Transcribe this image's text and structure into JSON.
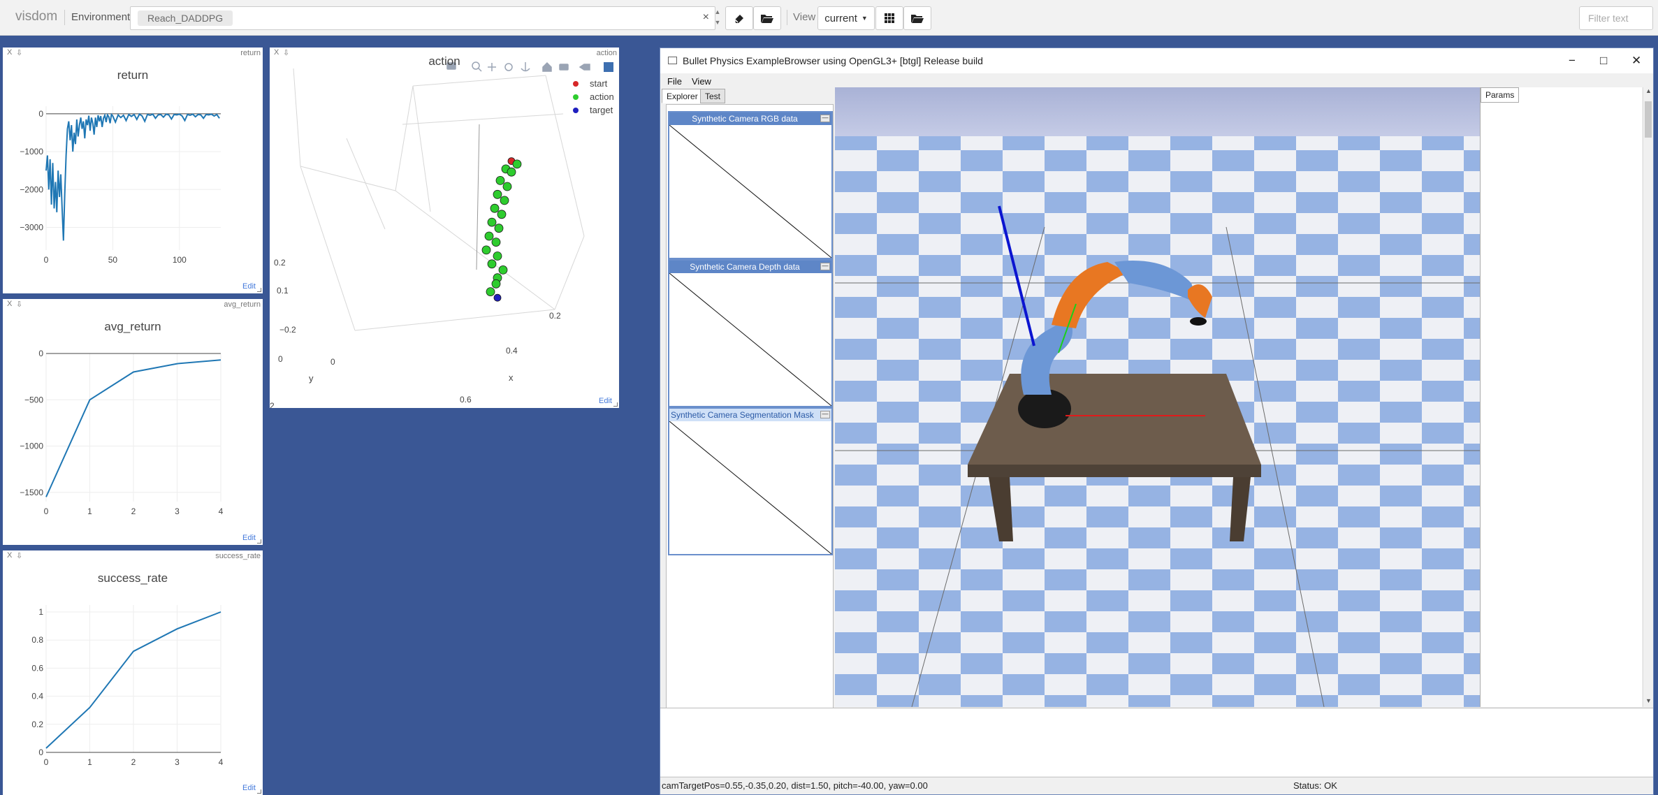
{
  "topbar": {
    "brand": "visdom",
    "env_label": "Environment",
    "env_chip": "Reach_DADDPG",
    "env_clear": "×",
    "view_label": "View",
    "view_value": "current",
    "filter_placeholder": "Filter text"
  },
  "panes": [
    {
      "close": "X",
      "name": "return",
      "edit": "Edit"
    },
    {
      "close": "X",
      "name": "action",
      "edit": "Edit"
    },
    {
      "close": "X",
      "name": "avg_return",
      "edit": "Edit"
    },
    {
      "close": "X",
      "name": "success_rate",
      "edit": "Edit"
    }
  ],
  "chart_data": [
    {
      "type": "line",
      "title": "return",
      "xlabel": "",
      "ylabel": "",
      "xlim": [
        0,
        131
      ],
      "ylim": [
        -3600,
        200
      ],
      "xticks": [
        "0",
        "50",
        "100"
      ],
      "yticks": [
        "0",
        "−1000",
        "−2000",
        "−3000"
      ],
      "series": [
        {
          "color": "#1f77b4",
          "x": [
            0,
            1,
            2,
            3,
            4,
            5,
            6,
            7,
            8,
            9,
            10,
            11,
            12,
            13,
            14,
            15,
            16,
            17,
            18,
            19,
            20,
            21,
            22,
            23,
            24,
            25,
            26,
            27,
            28,
            29,
            30,
            31,
            32,
            33,
            34,
            35,
            36,
            37,
            38,
            39,
            40,
            41,
            42,
            43,
            44,
            45,
            46,
            47,
            48,
            49,
            50,
            52,
            54,
            56,
            58,
            60,
            62,
            64,
            66,
            68,
            70,
            72,
            74,
            76,
            78,
            80,
            82,
            84,
            86,
            88,
            90,
            92,
            94,
            96,
            98,
            100,
            102,
            104,
            106,
            108,
            110,
            112,
            114,
            116,
            118,
            120,
            122,
            124,
            126,
            128,
            130
          ],
          "y": [
            -1500,
            -1100,
            -2000,
            -1200,
            -2400,
            -1300,
            -2500,
            -1800,
            -2600,
            -1500,
            -2200,
            -1600,
            -2500,
            -3350,
            -2100,
            -1100,
            -400,
            -200,
            -700,
            -300,
            -1000,
            -500,
            -800,
            -150,
            -600,
            -300,
            -100,
            -400,
            -200,
            -650,
            -150,
            -300,
            -50,
            -450,
            -100,
            -250,
            -550,
            -100,
            -350,
            -40,
            -200,
            -60,
            -350,
            -120,
            -40,
            -220,
            -30,
            -80,
            -250,
            -20,
            -60,
            -220,
            -30,
            -100,
            -40,
            -180,
            -20,
            -70,
            -20,
            -150,
            -10,
            -60,
            -200,
            -20,
            -40,
            -10,
            -120,
            -30,
            -20,
            -90,
            -10,
            -30,
            -140,
            -20,
            -30,
            -10,
            -60,
            -180,
            -20,
            -40,
            -10,
            -80,
            -20,
            -30,
            -120,
            -20,
            -30,
            -10,
            -60,
            -20,
            -120
          ]
        }
      ]
    },
    {
      "type": "scatter3d",
      "title": "action",
      "xlabel": "x",
      "ylabel": "y",
      "series": [
        {
          "name": "start",
          "color": "#d62728",
          "points": [
            [
              0.55,
              0.12,
              0.21
            ]
          ]
        },
        {
          "name": "action",
          "color": "#2ecc2e",
          "points": [
            [
              0.56,
              0.11,
              0.2
            ],
            [
              0.54,
              0.13,
              0.19
            ],
            [
              0.55,
              0.12,
              0.18
            ],
            [
              0.53,
              0.14,
              0.16
            ],
            [
              0.54,
              0.12,
              0.14
            ],
            [
              0.52,
              0.13,
              0.12
            ],
            [
              0.53,
              0.11,
              0.1
            ],
            [
              0.51,
              0.12,
              0.08
            ],
            [
              0.52,
              0.1,
              0.06
            ],
            [
              0.5,
              0.11,
              0.04
            ],
            [
              0.51,
              0.09,
              0.02
            ],
            [
              0.49,
              0.1,
              0.0
            ],
            [
              0.5,
              0.08,
              -0.02
            ],
            [
              0.48,
              0.09,
              -0.04
            ],
            [
              0.5,
              0.07,
              -0.06
            ],
            [
              0.49,
              0.08,
              -0.08
            ],
            [
              0.51,
              0.06,
              -0.1
            ],
            [
              0.5,
              0.07,
              -0.12
            ],
            [
              0.49,
              0.05,
              -0.14
            ],
            [
              0.48,
              0.06,
              -0.16
            ]
          ]
        },
        {
          "name": "target",
          "color": "#1f1fbf",
          "points": [
            [
              0.49,
              0.04,
              -0.18
            ]
          ]
        }
      ],
      "ticks": {
        "x": [
          "0.2",
          "0.4",
          "0.6"
        ],
        "y": [
          "0",
          "0.2"
        ],
        "z": [
          "−0.2",
          "0",
          "0.1",
          "0.2"
        ]
      }
    },
    {
      "type": "line",
      "title": "avg_return",
      "xlabel": "",
      "ylabel": "",
      "xlim": [
        0,
        4
      ],
      "ylim": [
        -1600,
        0
      ],
      "xticks": [
        "0",
        "1",
        "2",
        "3",
        "4"
      ],
      "yticks": [
        "0",
        "−500",
        "−1000",
        "−1500"
      ],
      "series": [
        {
          "color": "#1f77b4",
          "x": [
            0,
            1,
            2,
            3,
            4
          ],
          "y": [
            -1550,
            -500,
            -200,
            -110,
            -70
          ]
        }
      ]
    },
    {
      "type": "line",
      "title": "success_rate",
      "xlabel": "",
      "ylabel": "",
      "xlim": [
        0,
        4
      ],
      "ylim": [
        0,
        1.05
      ],
      "xticks": [
        "0",
        "1",
        "2",
        "3",
        "4"
      ],
      "yticks": [
        "0",
        "0.2",
        "0.4",
        "0.6",
        "0.8",
        "1"
      ],
      "series": [
        {
          "color": "#1f77b4",
          "x": [
            0,
            1,
            2,
            3,
            4
          ],
          "y": [
            0.03,
            0.32,
            0.72,
            0.88,
            1.0
          ]
        }
      ]
    }
  ],
  "bullet": {
    "title": "Bullet Physics ExampleBrowser using OpenGL3+ [btgl] Release build",
    "menu": [
      "File",
      "View"
    ],
    "tabs": [
      "Explorer",
      "Test"
    ],
    "cams": [
      "Synthetic Camera RGB data",
      "Synthetic Camera Depth data",
      "Synthetic Camera Segmentation Mask"
    ],
    "cam_btn": "—",
    "params_tab": "Params",
    "status_left": "camTargetPos=0.55,-0.35,0.20, dist=1.50, pitch=-40.00, yaw=0.00",
    "status_right": "Status: OK",
    "win_min": "−",
    "win_max": "□",
    "win_close": "✕"
  }
}
